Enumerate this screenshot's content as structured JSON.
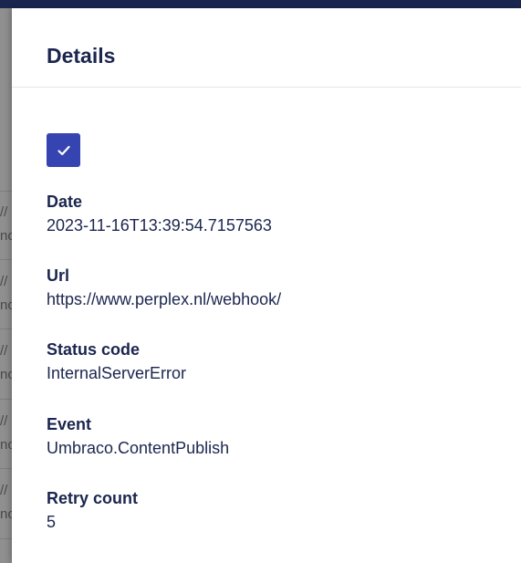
{
  "header": {
    "title": "Details"
  },
  "success_checkbox": {
    "checked": true,
    "icon": "check-icon",
    "color": "#3544b1"
  },
  "fields": [
    {
      "label": "Date",
      "value": "2023-11-16T13:39:54.7157563"
    },
    {
      "label": "Url",
      "value": "https://www.perplex.nl/webhook/"
    },
    {
      "label": "Status code",
      "value": "InternalServerError"
    },
    {
      "label": "Event",
      "value": "Umbraco.ContentPublish"
    },
    {
      "label": "Retry count",
      "value": "5"
    }
  ],
  "background_rows": [
    {
      "line1": "//",
      "line2": "no"
    },
    {
      "line1": "//",
      "line2": "no"
    },
    {
      "line1": "//",
      "line2": "no"
    },
    {
      "line1": "//",
      "line2": "no"
    },
    {
      "line1": "//",
      "line2": "no"
    }
  ],
  "colors": {
    "topbar": "#1b264f",
    "text": "#1b264f",
    "accent": "#3544b1",
    "overlay": "#8f8f8f"
  }
}
